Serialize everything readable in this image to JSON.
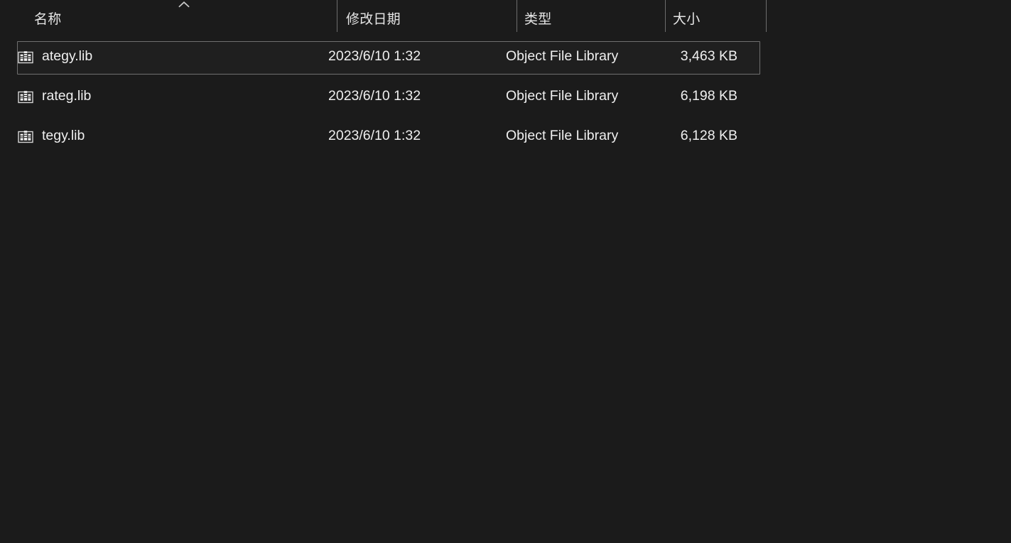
{
  "window": {
    "background_color": "#1b1b1b",
    "text_color": "#efefef"
  },
  "columns": [
    {
      "key": "name",
      "label": "名称",
      "sort_indicator": "chevron-up-icon"
    },
    {
      "key": "date",
      "label": "修改日期",
      "sort_indicator": null
    },
    {
      "key": "type",
      "label": "类型",
      "sort_indicator": null
    },
    {
      "key": "size",
      "label": "大小",
      "sort_indicator": null
    }
  ],
  "rows": [
    {
      "icon": "library-file-icon",
      "name": "ategy.lib",
      "date": "2023/6/10 1:32",
      "type": "Object File Library",
      "size": "3,463 KB",
      "selected": true
    },
    {
      "icon": "library-file-icon",
      "name": "rateg.lib",
      "date": "2023/6/10 1:32",
      "type": "Object File Library",
      "size": "6,198 KB",
      "selected": false
    },
    {
      "icon": "library-file-icon",
      "name": "tegy.lib",
      "date": "2023/6/10 1:32",
      "type": "Object File Library",
      "size": "6,128 KB",
      "selected": false
    }
  ]
}
